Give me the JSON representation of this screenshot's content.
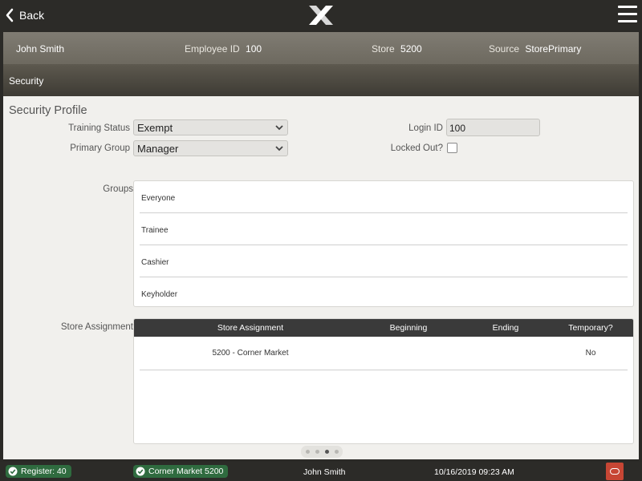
{
  "topbar": {
    "back_label": "Back"
  },
  "employee": {
    "name": "John Smith",
    "employee_id_label": "Employee ID",
    "employee_id": "100",
    "store_label": "Store",
    "store": "5200",
    "source_label": "Source",
    "source": "StorePrimary"
  },
  "section_bar": {
    "title": "Security"
  },
  "profile": {
    "title": "Security Profile",
    "training_status_label": "Training Status",
    "training_status_value": "Exempt",
    "primary_group_label": "Primary Group",
    "primary_group_value": "Manager",
    "login_id_label": "Login ID",
    "login_id_value": "100",
    "locked_out_label": "Locked Out?",
    "locked_out": false
  },
  "groups": {
    "label": "Groups",
    "items": [
      "Everyone",
      "Trainee",
      "Cashier",
      "Keyholder"
    ]
  },
  "store_assignment": {
    "label": "Store Assignment",
    "columns": [
      "Store Assignment",
      "Beginning",
      "Ending",
      "Temporary?"
    ],
    "rows": [
      {
        "store": "5200 - Corner Market",
        "beginning": "",
        "ending": "",
        "temporary": "No"
      }
    ]
  },
  "pager": {
    "pages": 4,
    "active_page": 3
  },
  "statusbar": {
    "register": "Register: 40",
    "store": "Corner Market 5200",
    "user": "John Smith",
    "datetime": "10/16/2019 09:23 AM"
  },
  "colors": {
    "topbar": "#2c2b28",
    "status_pill": "#2f6b3f",
    "oracle_button": "#c74634",
    "panel_bg": "#f1f0ed"
  },
  "icons": {
    "back": "chevron-left-icon",
    "logo": "x-logo-icon",
    "menu": "hamburger-menu-icon",
    "status_ok": "check-circle-icon",
    "oracle": "oracle-icon"
  }
}
